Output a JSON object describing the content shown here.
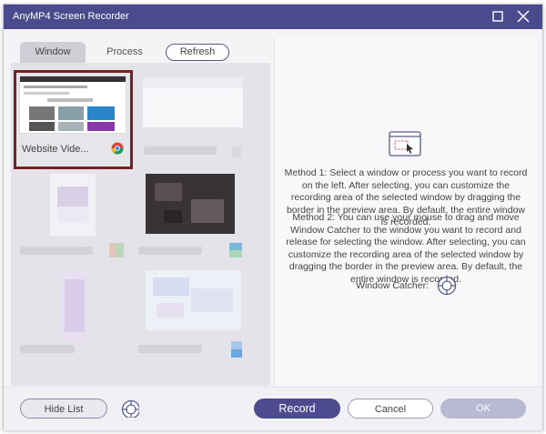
{
  "app": {
    "title": "AnyMP4 Screen Recorder"
  },
  "tabs": {
    "window": "Window",
    "process": "Process",
    "refresh": "Refresh"
  },
  "windows": [
    {
      "label": "Website Vide...",
      "selected": true,
      "icon": "chrome-icon"
    }
  ],
  "right": {
    "method1": "Method 1: Select a window or process you want to record on the left. After selecting, you can customize the recording area of the selected window by dragging the border in the preview area. By default, the entire window is recorded.",
    "method2": "Method 2: You can use your mouse to drag and move Window Catcher to the window you want to record and release for selecting the window. After selecting, you can customize the recording area of the selected window by dragging the border in the preview area. By default, the entire window is recorded.",
    "window_catcher_label": "Window Catcher:"
  },
  "bottom": {
    "hide_list": "Hide List",
    "record": "Record",
    "cancel": "Cancel",
    "ok": "OK"
  },
  "colors": {
    "titlebar": "#4a4a8c",
    "accent": "#4d4a8e",
    "selected_border": "#7a2020",
    "ok_disabled": "#b9b9d3"
  }
}
